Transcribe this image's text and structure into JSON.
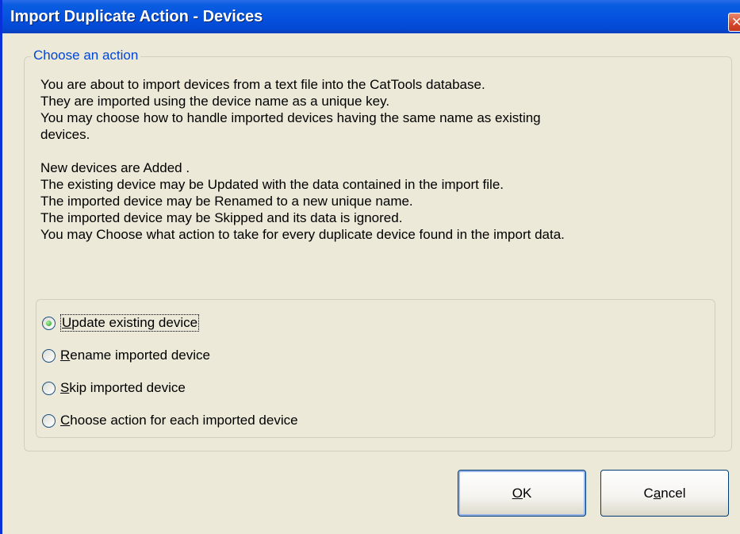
{
  "window": {
    "title": "Import Duplicate Action - Devices",
    "close_icon": "close-icon"
  },
  "group": {
    "caption": "Choose an action",
    "lines": [
      "You are about to import devices from a text file into the CatTools database.",
      "They are imported using the device name as a unique key.",
      "You may choose how to handle imported devices having the same name as existing",
      "devices.",
      "",
      "New devices are  Added .",
      "The existing device may be  Updated  with the data contained in the import file.",
      "The imported device may be  Renamed  to a new unique name.",
      "The imported device may be  Skipped  and its data is ignored.",
      "You may  Choose  what action to take for every duplicate device found in the import data."
    ]
  },
  "options": [
    {
      "accel": "U",
      "rest": "pdate  existing device",
      "selected": true
    },
    {
      "accel": "R",
      "rest": "ename  imported device",
      "selected": false
    },
    {
      "accel": "S",
      "rest": "kip imported device",
      "selected": false
    },
    {
      "accel": "C",
      "rest": "hoose  action for each imported device",
      "selected": false
    }
  ],
  "buttons": {
    "ok_accel": "O",
    "ok_rest": "K",
    "cancel_pre": "C",
    "cancel_accel": "a",
    "cancel_rest": "ncel"
  },
  "colors": {
    "titlebar": "#0553e0",
    "caption": "#0046d5",
    "dialog_bg": "#ece9d8"
  }
}
